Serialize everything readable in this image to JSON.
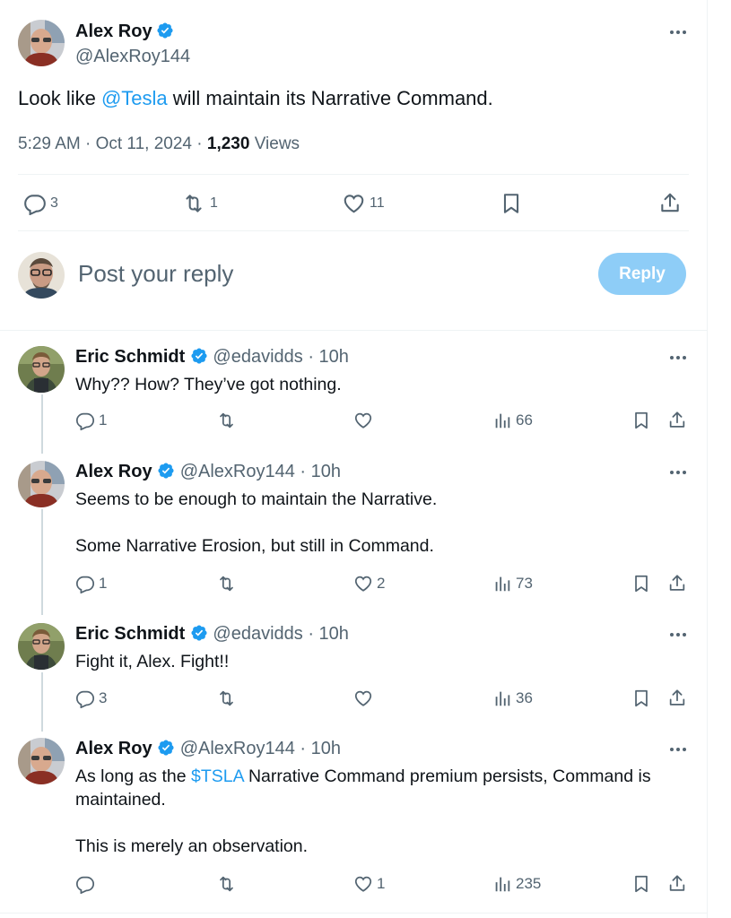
{
  "main_tweet": {
    "author_name": "Alex Roy",
    "author_handle": "@AlexRoy144",
    "text_before": "Look like ",
    "mention": "@Tesla",
    "text_after": " will maintain its Narrative Command.",
    "timestamp": "5:29 AM · Oct 11, 2024 · ",
    "views_count": "1,230",
    "views_label": " Views",
    "replies": "3",
    "retweets": "1",
    "likes": "11"
  },
  "reply_composer": {
    "placeholder": "Post your reply",
    "button_label": "Reply"
  },
  "replies": [
    {
      "name": "Eric Schmidt",
      "handle": "@edavidds",
      "time": " · 10h",
      "lines": [
        "Why?? How? They’ve got nothing."
      ],
      "reply_count": "1",
      "retweet_count": "",
      "like_count": "",
      "views": "66"
    },
    {
      "name": "Alex Roy",
      "handle": "@AlexRoy144",
      "time": " · 10h",
      "lines": [
        "Seems to be enough to maintain the Narrative.",
        "Some Narrative Erosion, but still in Command."
      ],
      "reply_count": "1",
      "retweet_count": "",
      "like_count": "2",
      "views": "73"
    },
    {
      "name": "Eric Schmidt",
      "handle": "@edavidds",
      "time": " · 10h",
      "lines": [
        "Fight it, Alex. Fight!!"
      ],
      "reply_count": "3",
      "retweet_count": "",
      "like_count": "",
      "views": "36"
    },
    {
      "name": "Alex Roy",
      "handle": "@AlexRoy144",
      "time": " · 10h",
      "text_before": "As long as the ",
      "cashtag": "$TSLA",
      "text_after": " Narrative Command premium persists, Command is",
      "line2": "maintained.",
      "line3": "This is merely an observation.",
      "reply_count": "",
      "retweet_count": "",
      "like_count": "1",
      "views": "235"
    }
  ],
  "colors": {
    "accent": "#1d9bf0",
    "muted": "#536471",
    "reply_button": "#8ecdf7"
  },
  "icons": [
    "verified-badge-icon",
    "more-icon",
    "reply-icon",
    "retweet-icon",
    "like-icon",
    "bookmark-icon",
    "share-icon",
    "views-icon"
  ]
}
